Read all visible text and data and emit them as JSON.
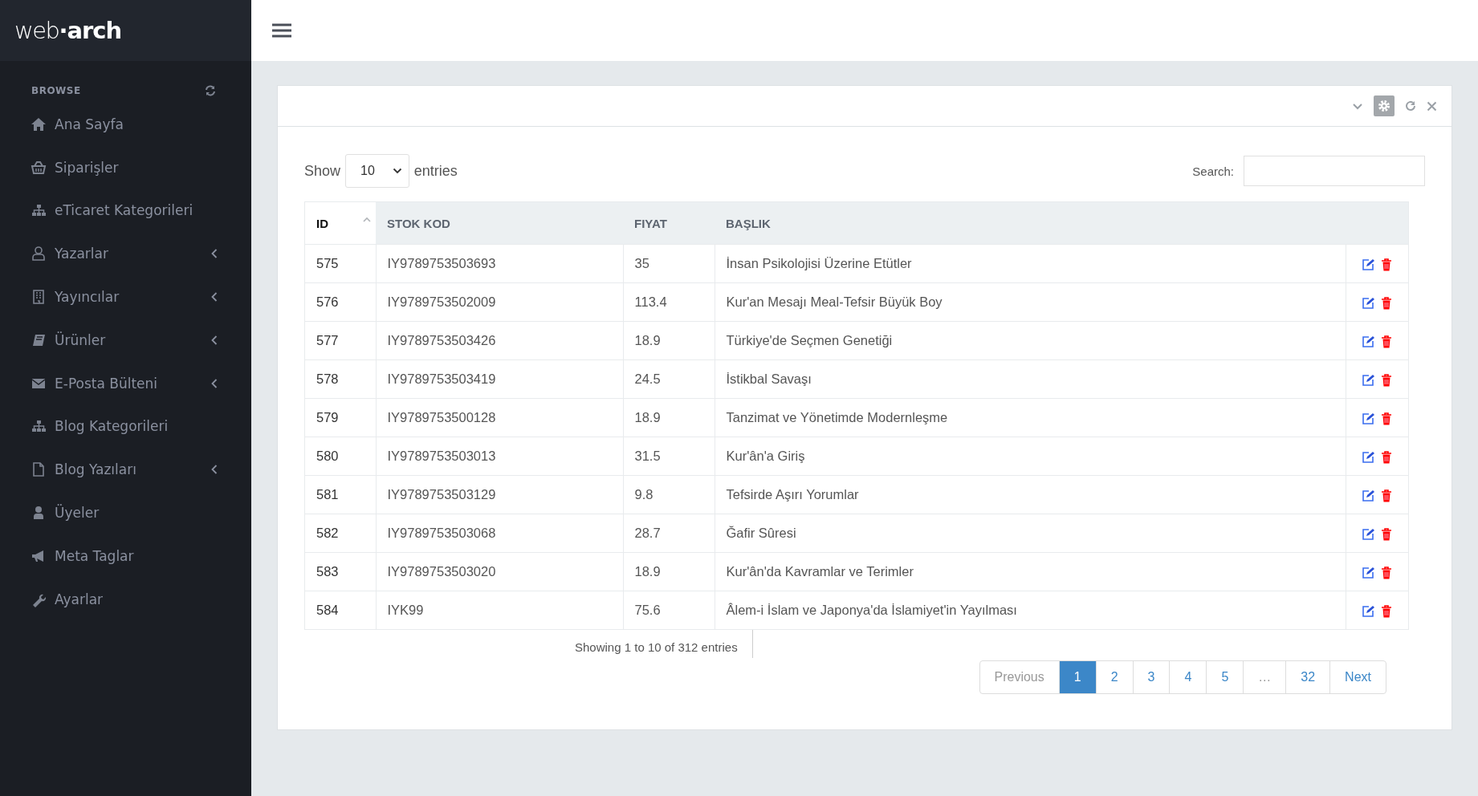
{
  "logo": "web**·arch**",
  "sidebar": {
    "heading": "BROWSE",
    "items": [
      {
        "label": "Ana Sayfa",
        "expandable": false
      },
      {
        "label": "Siparişler",
        "expandable": false
      },
      {
        "label": "eTicaret Kategorileri",
        "expandable": false
      },
      {
        "label": "Yazarlar",
        "expandable": true
      },
      {
        "label": "Yayıncılar",
        "expandable": true
      },
      {
        "label": "Ürünler",
        "expandable": true
      },
      {
        "label": "E-Posta Bülteni",
        "expandable": true
      },
      {
        "label": "Blog Kategorileri",
        "expandable": false
      },
      {
        "label": "Blog Yazıları",
        "expandable": true
      },
      {
        "label": "Üyeler",
        "expandable": false
      },
      {
        "label": "Meta Taglar",
        "expandable": false
      },
      {
        "label": "Ayarlar",
        "expandable": false
      }
    ]
  },
  "length_menu": {
    "before": "Show",
    "value": "10",
    "after": "entries"
  },
  "search": {
    "label": "Search:"
  },
  "table": {
    "columns": [
      {
        "label": "ID",
        "sorted": true
      },
      {
        "label": "STOK KOD",
        "sorted": false
      },
      {
        "label": "FIYAT",
        "sorted": false
      },
      {
        "label": "BAŞLIK",
        "sorted": false
      }
    ],
    "rows": [
      [
        "575",
        "IY9789753503693",
        "35",
        "İnsan Psikolojisi Üzerine Etütler"
      ],
      [
        "576",
        "IY9789753502009",
        "113.4",
        "Kur'an Mesajı Meal-Tefsir Büyük Boy"
      ],
      [
        "577",
        "IY9789753503426",
        "18.9",
        "Türkiye'de Seçmen Genetiği"
      ],
      [
        "578",
        "IY9789753503419",
        "24.5",
        "İstikbal Savaşı"
      ],
      [
        "579",
        "IY9789753500128",
        "18.9",
        "Tanzimat ve Yönetimde Modernleşme"
      ],
      [
        "580",
        "IY9789753503013",
        "31.5",
        "Kur'ân'a Giriş"
      ],
      [
        "581",
        "IY9789753503129",
        "9.8",
        "Tefsirde Aşırı Yorumlar"
      ],
      [
        "582",
        "IY9789753503068",
        "28.7",
        "Ğafir Sûresi"
      ],
      [
        "583",
        "IY9789753503020",
        "18.9",
        "Kur'ân'da Kavramlar ve Terimler"
      ],
      [
        "584",
        "IYK99",
        "75.6",
        "Âlem-i İslam ve Japonya'da İslamiyet'in Yayılması"
      ]
    ]
  },
  "info": "Showing 1 to 10 of 312 entries",
  "pagination": {
    "previous": {
      "label": "Previous",
      "disabled": true
    },
    "pages": [
      {
        "label": "1",
        "selected": true,
        "disabled": false
      },
      {
        "label": "2",
        "selected": false,
        "disabled": false
      },
      {
        "label": "3",
        "selected": false,
        "disabled": false
      },
      {
        "label": "4",
        "selected": false,
        "disabled": false
      },
      {
        "label": "5",
        "selected": false,
        "disabled": false
      },
      {
        "label": "…",
        "selected": false,
        "disabled": true
      },
      {
        "label": "32",
        "selected": false,
        "disabled": false
      }
    ],
    "next": {
      "label": "Next",
      "disabled": false
    }
  }
}
